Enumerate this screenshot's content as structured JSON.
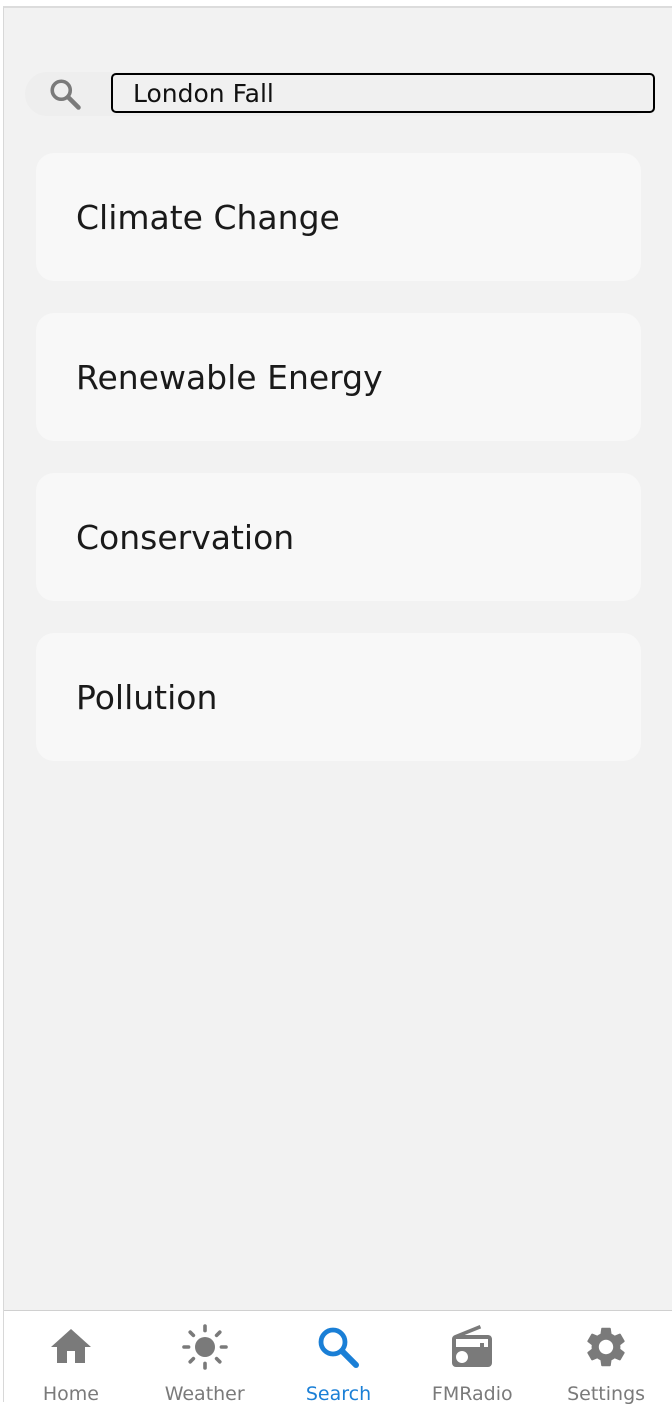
{
  "search": {
    "value": "London Fall",
    "placeholder": ""
  },
  "topics": [
    {
      "label": "Climate Change"
    },
    {
      "label": "Renewable Energy"
    },
    {
      "label": "Conservation"
    },
    {
      "label": "Pollution"
    }
  ],
  "tabs": [
    {
      "label": "Home",
      "icon": "home-icon",
      "active": false
    },
    {
      "label": "Weather",
      "icon": "sun-icon",
      "active": false
    },
    {
      "label": "Search",
      "icon": "search-icon",
      "active": true
    },
    {
      "label": "FMRadio",
      "icon": "radio-icon",
      "active": false
    },
    {
      "label": "Settings",
      "icon": "gear-icon",
      "active": false
    }
  ],
  "colors": {
    "accent": "#1a7fd6",
    "icon_gray": "#7a7a7a",
    "background": "#f2f2f2",
    "card": "#f8f8f8"
  }
}
